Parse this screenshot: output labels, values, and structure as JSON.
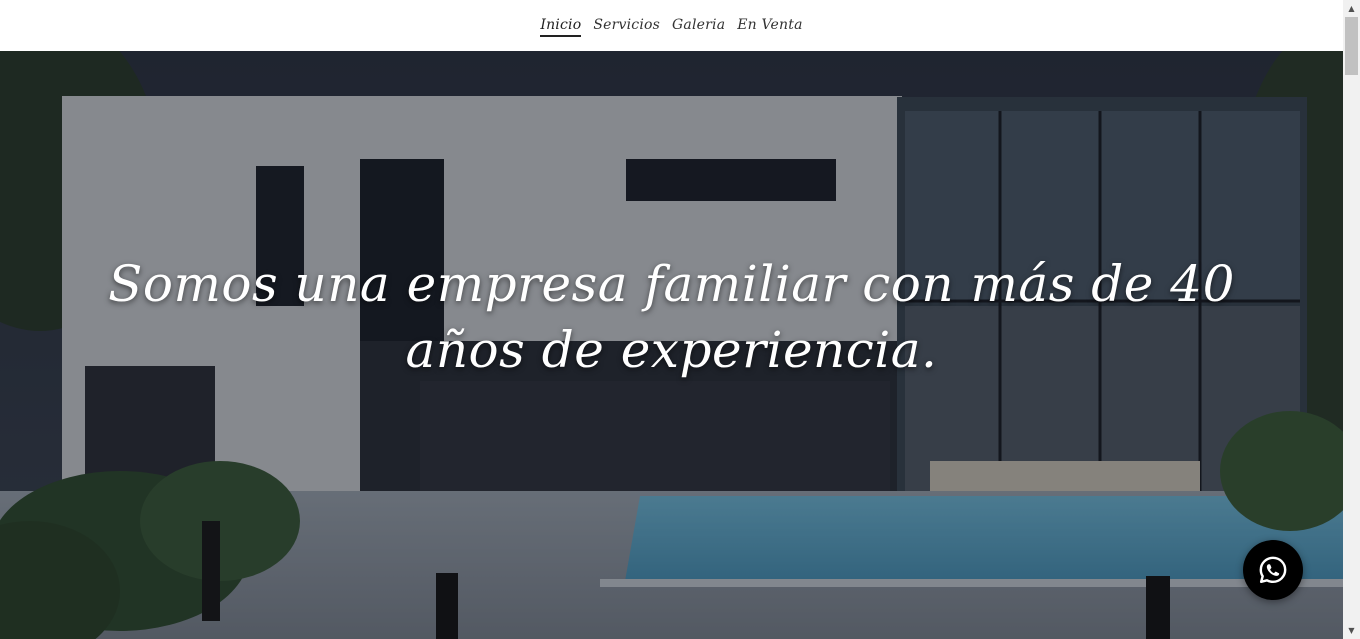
{
  "nav": {
    "items": [
      {
        "label": "Inicio",
        "active": true
      },
      {
        "label": "Servicios",
        "active": false
      },
      {
        "label": "Galeria",
        "active": false
      },
      {
        "label": "En Venta",
        "active": false
      }
    ]
  },
  "hero": {
    "headline": "Somos una empresa familiar con más de 40 años de experiencia."
  },
  "whatsapp": {
    "icon": "whatsapp-icon",
    "color": "#000000"
  },
  "colors": {
    "nav_text": "#333333",
    "hero_text": "#ffffff",
    "pool": "#5fa9c9"
  }
}
